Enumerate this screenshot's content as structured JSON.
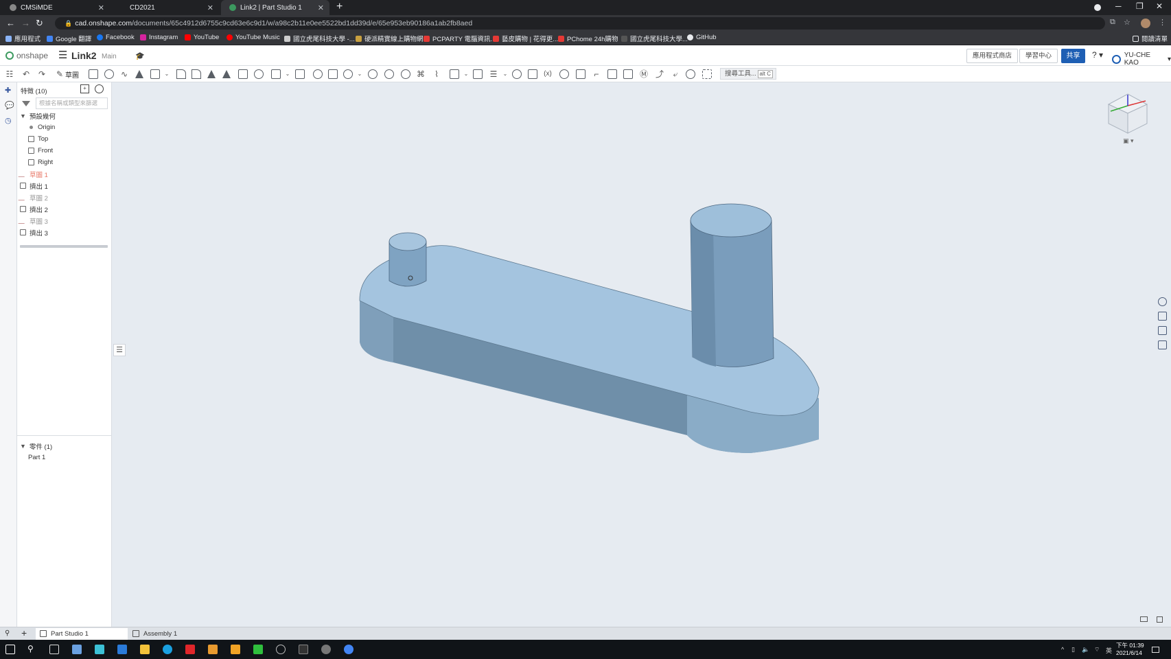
{
  "browser": {
    "tabs": [
      {
        "title": "CMSiMDE"
      },
      {
        "title": "CD2021"
      },
      {
        "title": "Link2 | Part Studio 1"
      }
    ],
    "url_host": "cad.onshape.com",
    "url_path": "/documents/65c4912d6755c9cd63e6c9d1/w/a98c2b11e0ee5522bd1dd39d/e/65e953eb90186a1ab2fb8aed",
    "bookmarks": [
      "應用程式",
      "Google 翻譯",
      "Facebook",
      "Instagram",
      "YouTube",
      "YouTube Music",
      "國立虎尾科技大學 -...",
      "硬派精實線上購物網",
      "PCPARTY 電腦資訊...",
      "藝皮購物 | 花得更...",
      "PChome 24h購物",
      "國立虎尾科技大學...",
      "GitHub"
    ],
    "reading_list": "閱讀清單"
  },
  "onshape": {
    "logo_text": "onshape",
    "doc_name": "Link2",
    "branch": "Main",
    "app_store": "應用程式商店",
    "learning_center": "學習中心",
    "share": "共享",
    "help": "?",
    "user": "YU-CHE KAO"
  },
  "toolbar": {
    "sketch": "草圖",
    "search_tools": "搜尋工具...",
    "search_shortcut": "alt C"
  },
  "features": {
    "title": "特徵 (10)",
    "filter_placeholder": "根據名稱或類型來篩選",
    "default_geometry": "預設幾何",
    "items": [
      {
        "label": "Origin"
      },
      {
        "label": "Top"
      },
      {
        "label": "Front"
      },
      {
        "label": "Right"
      },
      {
        "label": "草圖 1"
      },
      {
        "label": "擠出 1"
      },
      {
        "label": "草圖 2"
      },
      {
        "label": "擠出 2"
      },
      {
        "label": "草圖 3"
      },
      {
        "label": "擠出 3"
      }
    ],
    "parts_header": "零件 (1)",
    "parts": [
      {
        "label": "Part 1"
      }
    ]
  },
  "bottom_tabs": [
    {
      "label": "Part Studio 1"
    },
    {
      "label": "Assembly 1"
    }
  ],
  "taskbar": {
    "time_prefix": "下午",
    "time": "01:39",
    "date": "2021/6/14",
    "lang": "英"
  },
  "colors": {
    "model_top": "#a4c4df",
    "model_side": "#6f8fa9",
    "accent": "#1e5fb4"
  }
}
